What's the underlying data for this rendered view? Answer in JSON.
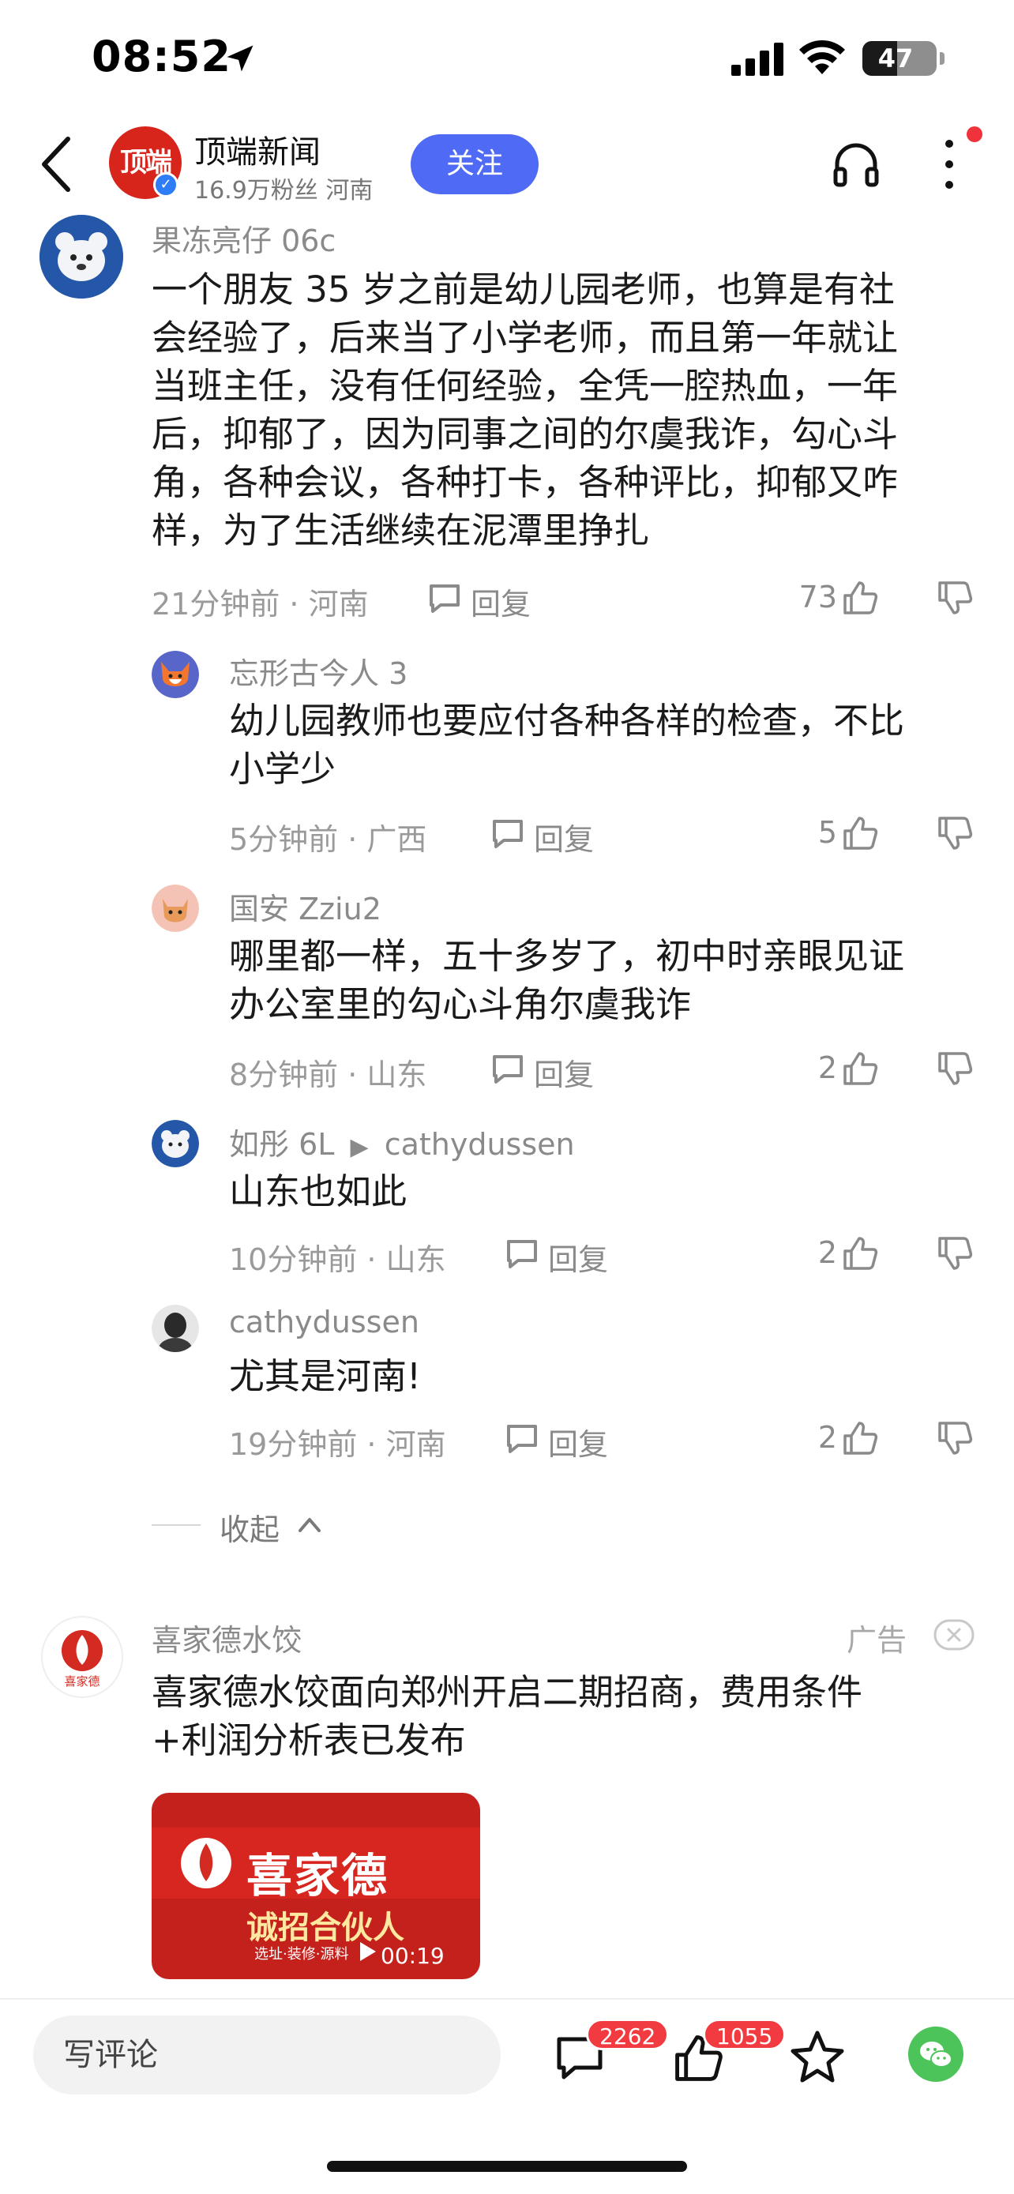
{
  "status_bar": {
    "time": "08:52",
    "battery": "47",
    "battery_level": 0.47
  },
  "header": {
    "account_name": "顶端新闻",
    "logo_text": "顶端",
    "meta": "16.9万粉丝 河南",
    "follow_label": "关注"
  },
  "comments": {
    "main": {
      "username": "果冻亮仔 06c",
      "content_lines": [
        "一个朋友 35 岁之前是幼儿园老师，也算是有社",
        "会经验了，后来当了小学老师，而且第一年就让",
        "当班主任，没有任何经验，全凭一腔热血，一年",
        "后，抑郁了，因为同事之间的尔虞我诈，勾心斗",
        "角，各种会议，各种打卡，各种评比，抑郁又咋",
        "样，为了生活继续在泥潭里挣扎"
      ],
      "meta": "21分钟前 · 河南",
      "reply_label": "回复",
      "likes": "73"
    },
    "replies": [
      {
        "username": "忘形古今人 3",
        "content_lines": [
          "幼儿园教师也要应付各种各样的检查，不比",
          "小学少"
        ],
        "meta": "5分钟前 · 广西",
        "reply_label": "回复",
        "likes": "5"
      },
      {
        "username": "国安 Zziu2",
        "content_lines": [
          "哪里都一样，五十多岁了，初中时亲眼见证",
          "办公室里的勾心斗角尔虞我诈"
        ],
        "meta": "8分钟前 · 山东",
        "reply_label": "回复",
        "likes": "2"
      },
      {
        "username": "如彤 6L",
        "reply_to_arrow": "▶",
        "reply_to": "cathydussen",
        "content_lines": [
          "山东也如此"
        ],
        "meta": "10分钟前 · 山东",
        "reply_label": "回复",
        "likes": "2"
      },
      {
        "username": "cathydussen",
        "content_lines": [
          "尤其是河南!"
        ],
        "meta": "19分钟前 · 河南",
        "reply_label": "回复",
        "likes": "2"
      }
    ],
    "collapse_label": "收起"
  },
  "ad": {
    "advertiser": "喜家德水饺",
    "avatar_text": "喜家德",
    "tag": "广告",
    "content_lines": [
      "喜家德水饺面向郑州开启二期招商，费用条件",
      "+利润分析表已发布"
    ],
    "thumb_brand": "喜家德",
    "thumb_banner": "诚招合伙人",
    "thumb_sub": "选址·装修·源料",
    "duration": "00:19"
  },
  "bottom_bar": {
    "input_placeholder": "写评论",
    "comment_count": "2262",
    "like_count": "1055"
  },
  "colors": {
    "accent": "#4f6af5",
    "badge": "#f23b40",
    "brand_red": "#d8251c",
    "wechat_green": "#4cc45a"
  },
  "icons": [
    "location-arrow-icon",
    "signal-icon",
    "wifi-icon",
    "battery-icon",
    "back-icon",
    "headphone-icon",
    "more-icon",
    "reply-icon",
    "like-icon",
    "dislike-icon",
    "chevron-up-icon",
    "close-icon",
    "play-icon",
    "comment-icon",
    "star-icon",
    "wechat-icon"
  ]
}
